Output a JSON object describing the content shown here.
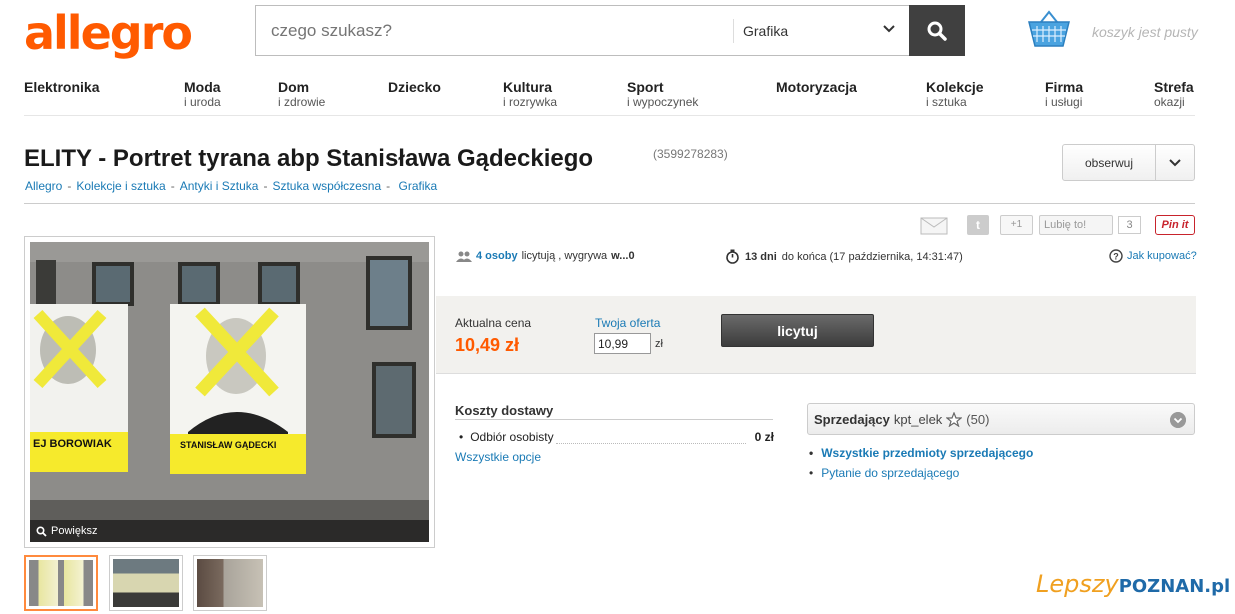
{
  "header": {
    "logo": "allegro",
    "search_placeholder": "czego szukasz?",
    "search_category": "Grafika",
    "cart_text": "koszyk jest pusty"
  },
  "nav": [
    {
      "main": "Elektronika",
      "sub": ""
    },
    {
      "main": "Moda",
      "sub": "i uroda"
    },
    {
      "main": "Dom",
      "sub": "i zdrowie"
    },
    {
      "main": "Dziecko",
      "sub": ""
    },
    {
      "main": "Kultura",
      "sub": "i rozrywka"
    },
    {
      "main": "Sport",
      "sub": "i wypoczynek"
    },
    {
      "main": "Motoryzacja",
      "sub": ""
    },
    {
      "main": "Kolekcje",
      "sub": "i sztuka"
    },
    {
      "main": "Firma",
      "sub": "i usługi"
    },
    {
      "main": "Strefa",
      "sub": "okazji"
    }
  ],
  "item": {
    "title": "ELITY - Portret tyrana abp Stanisława Gądeckiego",
    "id": "(3599278283)",
    "observe_label": "obserwuj"
  },
  "breadcrumbs": [
    "Allegro",
    "Kolekcje i sztuka",
    "Antyki i Sztuka",
    "Sztuka współczesna",
    "Grafika"
  ],
  "social": {
    "twitter": "t",
    "gplus": "+1",
    "fb_like": "Lubię to!",
    "fb_count": "3",
    "pinterest": "Pin it"
  },
  "image": {
    "zoom_label": "Powiększ",
    "banner_left": "EJ BOROWIAK",
    "banner_right": "STANISŁAW GĄDECKI"
  },
  "bid": {
    "bidders_link": "4 osoby",
    "bidders_text": "licytują , wygrywa",
    "winner": "w...0",
    "days": "13 dni",
    "end_text": "do końca (17 października, 14:31:47)",
    "how_to_buy": "Jak kupować?",
    "current_price_label": "Aktualna cena",
    "current_price": "10,49 zł",
    "your_offer_label": "Twoja oferta",
    "your_offer_value": "10,99",
    "currency": "zł",
    "bid_button": "licytuj"
  },
  "delivery": {
    "title": "Koszty dostawy",
    "option": "Odbiór osobisty",
    "price": "0 zł",
    "all_options": "Wszystkie opcje"
  },
  "seller": {
    "label": "Sprzedający",
    "nick": "kpt_elek",
    "rating": "(50)",
    "links": [
      "Wszystkie przedmioty sprzedającego",
      "Pytanie do sprzedającego"
    ]
  },
  "watermark": {
    "part1": "Lepszy",
    "part2": "POZNAN.pl"
  },
  "colors": {
    "brand": "#ff5a00",
    "link": "#1a7ab5"
  }
}
